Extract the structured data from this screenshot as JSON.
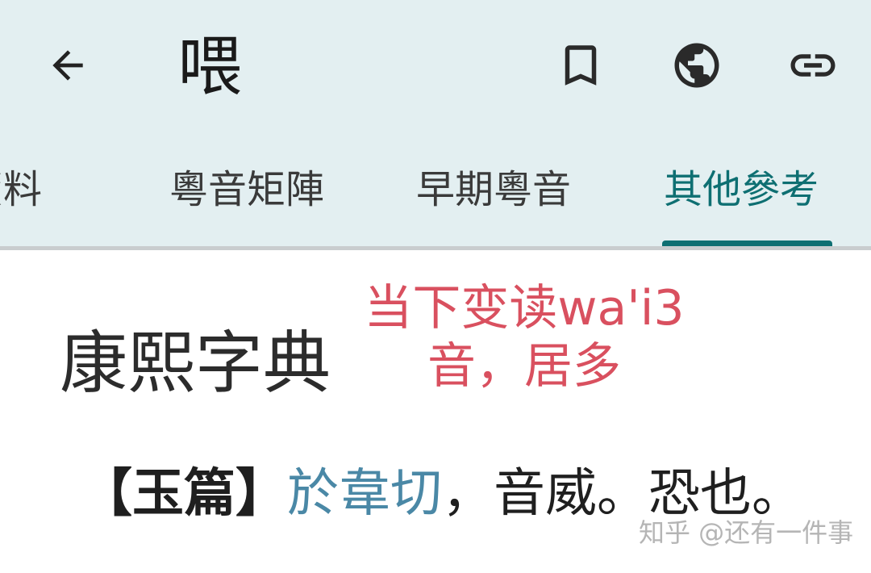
{
  "toolbar": {
    "back_icon": "arrow-left-icon",
    "title": "喂",
    "bookmark_icon": "bookmark-outline-icon",
    "globe_icon": "globe-icon",
    "link_icon": "link-icon"
  },
  "tabs": [
    {
      "label": "資料",
      "active": false
    },
    {
      "label": "粵音矩陣",
      "active": false
    },
    {
      "label": "早期粵音",
      "active": false
    },
    {
      "label": "其他參考",
      "active": true
    }
  ],
  "content": {
    "dictionary_title": "康熙字典",
    "annotation_line1": "当下变读wa'i3",
    "annotation_line2": "音，居多",
    "entry": {
      "source": "【玉篇】",
      "fanqie": "於韋切",
      "rest": "，音威。恐也。"
    }
  },
  "watermark": "知乎 @还有一件事",
  "colors": {
    "appbar_bg": "#e3eff1",
    "accent": "#0e6f72",
    "annotation": "#d9505f",
    "link": "#4a88a6"
  }
}
